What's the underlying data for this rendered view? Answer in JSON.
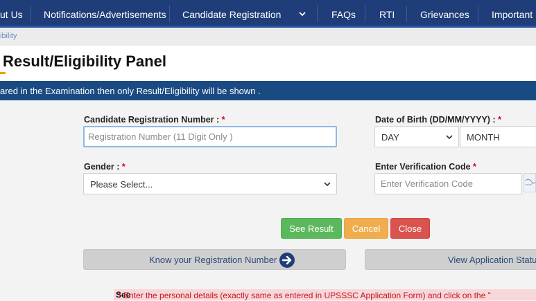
{
  "nav": {
    "items": [
      "ut Us",
      "Notifications/Advertisements",
      "Candidate Registration",
      "FAQs",
      "RTI",
      "Grievances",
      "Important L"
    ]
  },
  "breadcrumb": {
    "text": "ibility"
  },
  "page": {
    "title": "Result/Eligibility Panel"
  },
  "info_bar": {
    "text": "ared in the Examination then only Result/Eligibility will be shown ."
  },
  "form": {
    "reg_label": "Candidate Registration Number : ",
    "reg_placeholder": "Registration Number (11 Digit Only )",
    "dob_label": "Date of Birth (DD/MM/YYYY) : ",
    "dob_day": "DAY",
    "dob_month": "MONTH",
    "gender_label": "Gender : ",
    "gender_value": "Please Select...",
    "verif_label": "Enter Verification Code ",
    "verif_placeholder": "Enter Verification Code",
    "required_mark": "*"
  },
  "buttons": {
    "see_result": "See Result",
    "cancel": "Cancel",
    "close": "Close",
    "know_reg": "Know your Registration Number",
    "view_status": "View Application Statu"
  },
  "note": {
    "text": "* Enter the personal details (exactly same as entered in UPSSSC Application Form) and click on the \"",
    "bold": "See"
  },
  "colors": {
    "nav_bg": "#1f3d78",
    "info_bg": "#1a4a82",
    "green": "#5cb85c",
    "orange": "#f0ad4e",
    "red": "#d9534f"
  }
}
